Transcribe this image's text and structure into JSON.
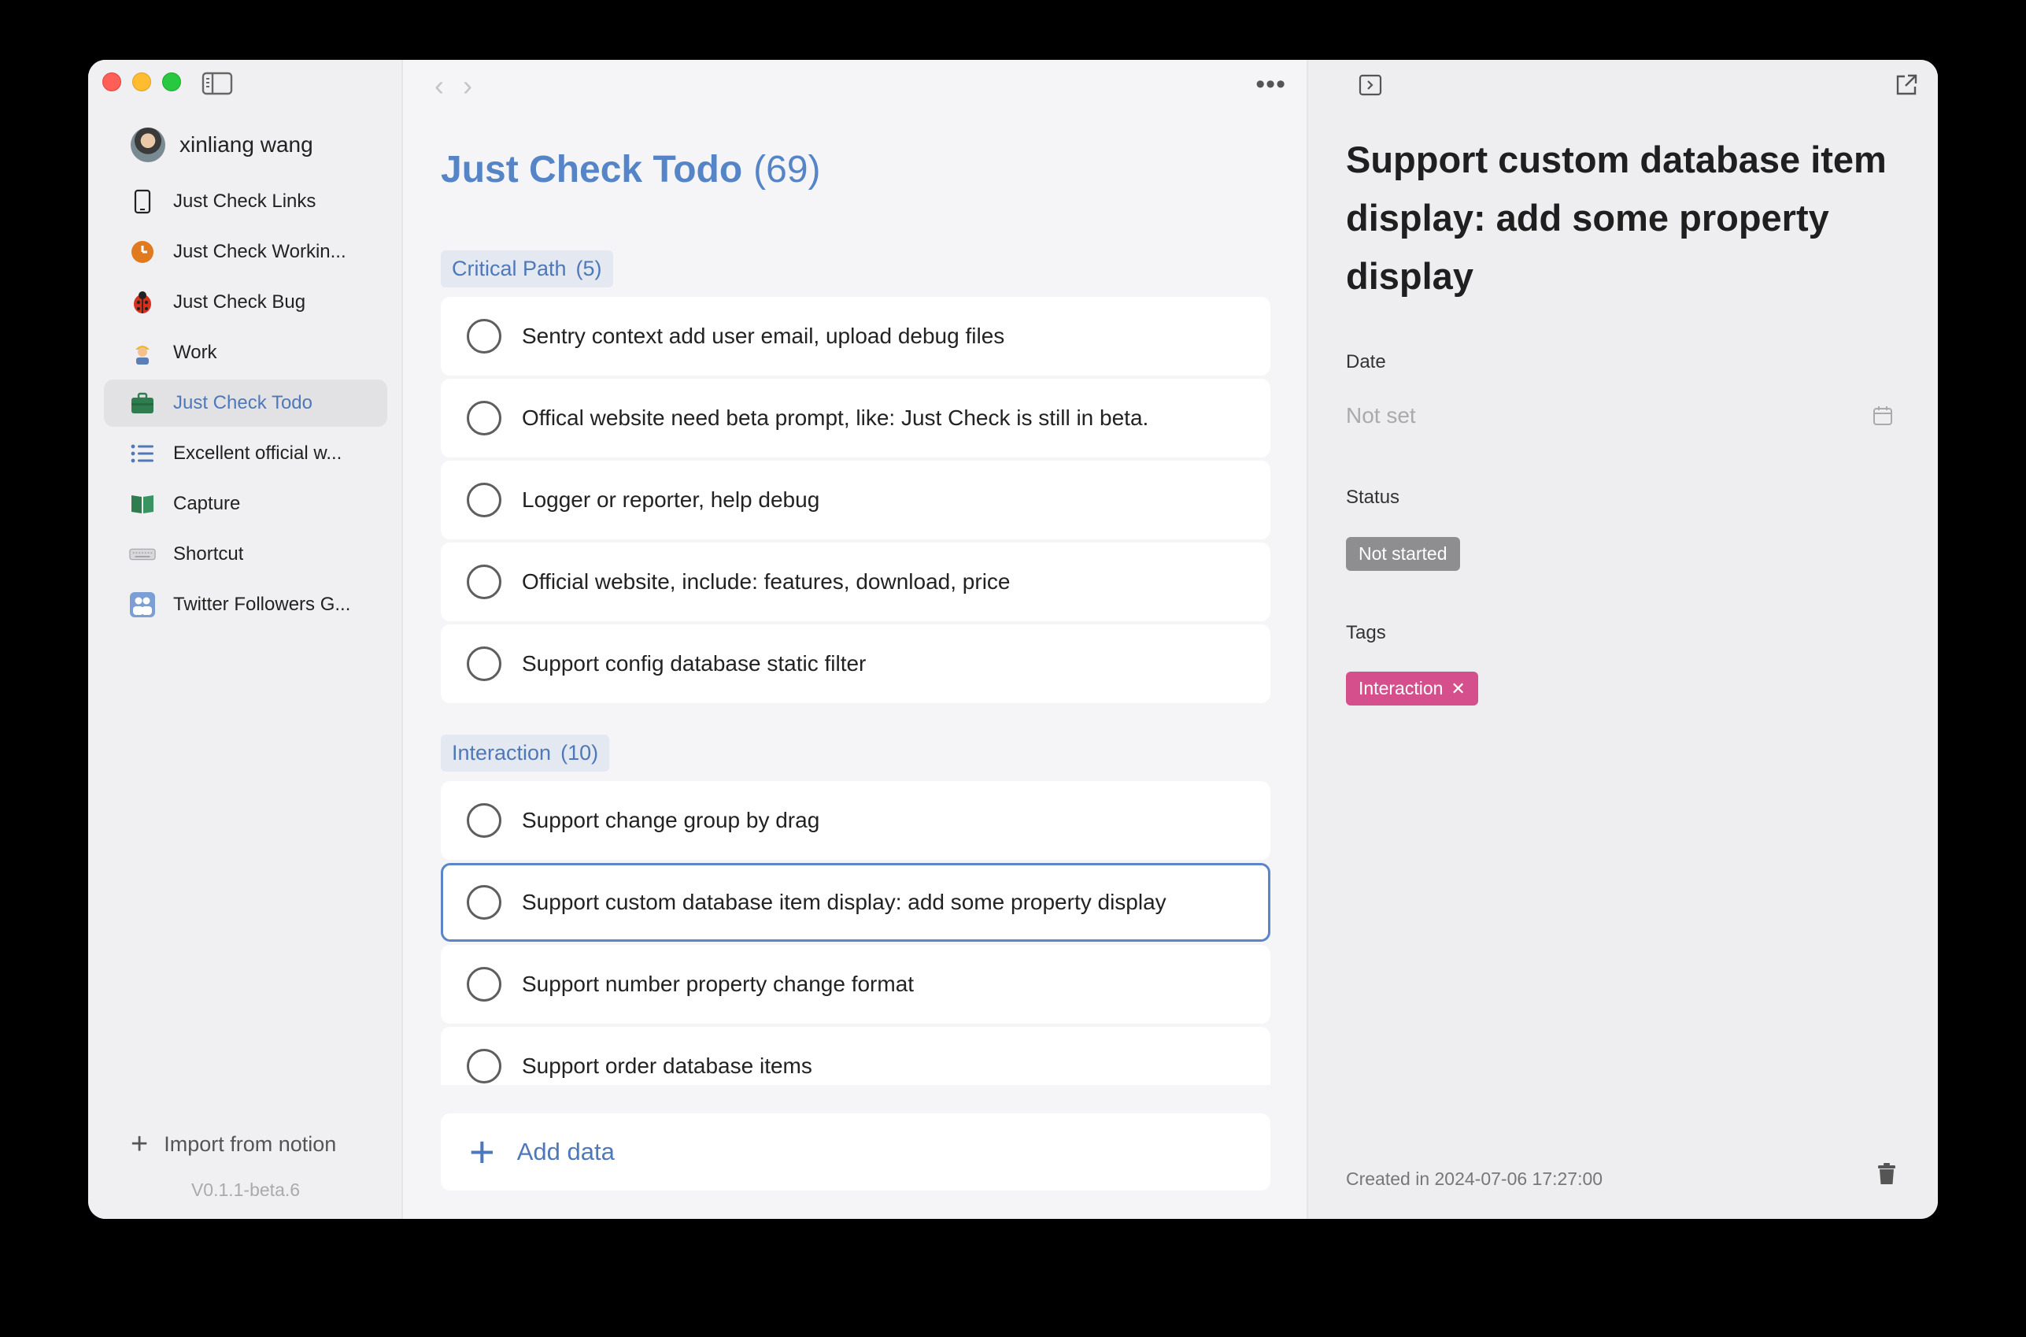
{
  "user": {
    "name": "xinliang wang"
  },
  "sidebar": {
    "items": [
      {
        "label": "Just Check Links",
        "icon": "phone-icon"
      },
      {
        "label": "Just Check Workin...",
        "icon": "clock-icon"
      },
      {
        "label": "Just Check Bug",
        "icon": "ladybug-icon"
      },
      {
        "label": "Work",
        "icon": "worker-icon"
      },
      {
        "label": "Just Check Todo",
        "icon": "briefcase-icon",
        "active": true
      },
      {
        "label": "Excellent official w...",
        "icon": "list-icon"
      },
      {
        "label": "Capture",
        "icon": "book-icon"
      },
      {
        "label": "Shortcut",
        "icon": "keyboard-icon"
      },
      {
        "label": "Twitter Followers G...",
        "icon": "people-icon"
      }
    ],
    "import_label": "Import from notion",
    "version": "V0.1.1-beta.6"
  },
  "main": {
    "title": "Just Check Todo",
    "count": "(69)",
    "groups": [
      {
        "name": "Critical Path",
        "count": "(5)",
        "tasks": [
          "Sentry context add user email, upload debug files",
          "Offical website need beta prompt, like: Just Check is still in beta.",
          "Logger or reporter, help debug",
          "Official website, include: features, download, price",
          "Support config database static filter"
        ]
      },
      {
        "name": "Interaction",
        "count": "(10)",
        "tasks": [
          "Support change group by drag",
          "Support custom database item display: add some property display",
          "Support number property change format",
          "Support order database items"
        ]
      }
    ],
    "add_label": "Add data"
  },
  "detail": {
    "title": "Support custom database item display: add some property display",
    "date_label": "Date",
    "date_value": "Not set",
    "status_label": "Status",
    "status_value": "Not started",
    "tags_label": "Tags",
    "tag": "Interaction",
    "created": "Created in 2024-07-06 17:27:00"
  },
  "colors": {
    "accent": "#5585c6",
    "tag": "#d64f8d",
    "status": "#8e8e90"
  }
}
